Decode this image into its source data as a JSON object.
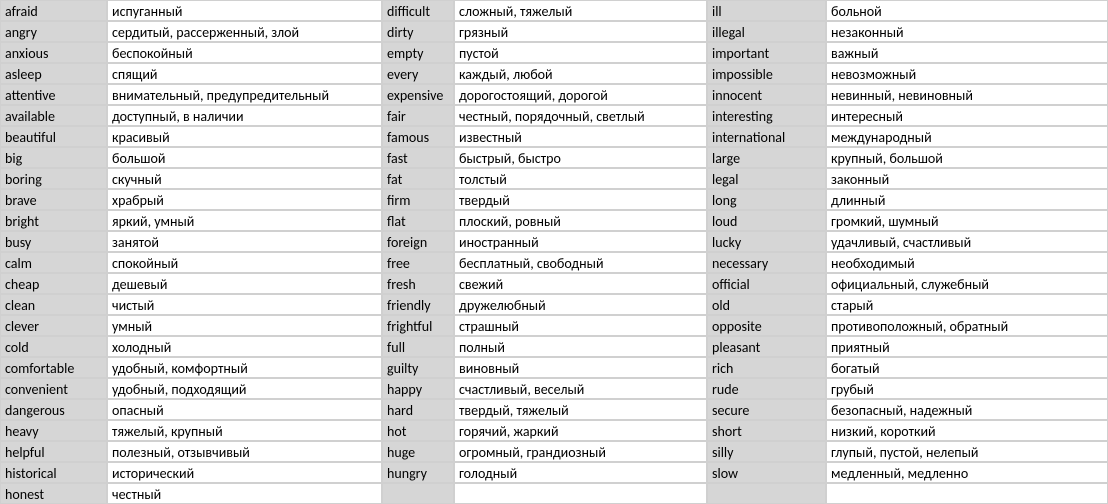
{
  "columns": [
    [
      {
        "en": "afraid",
        "ru": "испуганный"
      },
      {
        "en": "angry",
        "ru": "сердитый, рассерженный, злой"
      },
      {
        "en": "anxious",
        "ru": "беспокойный"
      },
      {
        "en": "asleep",
        "ru": "спящий"
      },
      {
        "en": "attentive",
        "ru": "внимательный, предупредительный"
      },
      {
        "en": "available",
        "ru": "доступный, в наличии"
      },
      {
        "en": "beautiful",
        "ru": "красивый"
      },
      {
        "en": "big",
        "ru": "большой"
      },
      {
        "en": "boring",
        "ru": "скучный"
      },
      {
        "en": "brave",
        "ru": "храбрый"
      },
      {
        "en": "bright",
        "ru": "яркий, умный"
      },
      {
        "en": "busy",
        "ru": "занятой"
      },
      {
        "en": "calm",
        "ru": "спокойный"
      },
      {
        "en": "cheap",
        "ru": "дешевый"
      },
      {
        "en": "clean",
        "ru": "чистый"
      },
      {
        "en": "clever",
        "ru": "умный"
      },
      {
        "en": "cold",
        "ru": "холодный"
      },
      {
        "en": "comfortable",
        "ru": "удобный, комфортный"
      },
      {
        "en": "convenient",
        "ru": "удобный, подходящий"
      },
      {
        "en": "dangerous",
        "ru": "опасный"
      },
      {
        "en": "heavy",
        "ru": "тяжелый, крупный"
      },
      {
        "en": "helpful",
        "ru": "полезный, отзывчивый"
      },
      {
        "en": "historical",
        "ru": "исторический"
      },
      {
        "en": "honest",
        "ru": "честный"
      }
    ],
    [
      {
        "en": "difficult",
        "ru": "сложный, тяжелый"
      },
      {
        "en": "dirty",
        "ru": "грязный"
      },
      {
        "en": "empty",
        "ru": "пустой"
      },
      {
        "en": "every",
        "ru": "каждый, любой"
      },
      {
        "en": "expensive",
        "ru": "дорогостоящий, дорогой"
      },
      {
        "en": "fair",
        "ru": "честный, порядочный, светлый"
      },
      {
        "en": "famous",
        "ru": "известный"
      },
      {
        "en": "fast",
        "ru": "быстрый, быстро"
      },
      {
        "en": "fat",
        "ru": "толстый"
      },
      {
        "en": "firm",
        "ru": "твердый"
      },
      {
        "en": "flat",
        "ru": "плоский, ровный"
      },
      {
        "en": "foreign",
        "ru": "иностранный"
      },
      {
        "en": "free",
        "ru": "бесплатный, свободный"
      },
      {
        "en": "fresh",
        "ru": "свежий"
      },
      {
        "en": "friendly",
        "ru": "дружелюбный"
      },
      {
        "en": "frightful",
        "ru": "страшный"
      },
      {
        "en": "full",
        "ru": "полный"
      },
      {
        "en": "guilty",
        "ru": "виновный"
      },
      {
        "en": "happy",
        "ru": "счастливый, веселый"
      },
      {
        "en": "hard",
        "ru": "твердый, тяжелый"
      },
      {
        "en": "hot",
        "ru": "горячий, жаркий"
      },
      {
        "en": "huge",
        "ru": "огромный, грандиозный"
      },
      {
        "en": "hungry",
        "ru": "голодный"
      },
      {
        "en": "",
        "ru": ""
      }
    ],
    [
      {
        "en": "ill",
        "ru": "больной"
      },
      {
        "en": "illegal",
        "ru": "незаконный"
      },
      {
        "en": "important",
        "ru": "важный"
      },
      {
        "en": "impossible",
        "ru": "невозможный"
      },
      {
        "en": "innocent",
        "ru": "невинный, невиновный"
      },
      {
        "en": "interesting",
        "ru": "интересный"
      },
      {
        "en": "international",
        "ru": "международный"
      },
      {
        "en": "large",
        "ru": "крупный, большой"
      },
      {
        "en": "legal",
        "ru": "законный"
      },
      {
        "en": "long",
        "ru": "длинный"
      },
      {
        "en": "loud",
        "ru": "громкий, шумный"
      },
      {
        "en": "lucky",
        "ru": "удачливый, счастливый"
      },
      {
        "en": "necessary",
        "ru": "необходимый"
      },
      {
        "en": "official",
        "ru": "официальный, служебный"
      },
      {
        "en": "old",
        "ru": "старый"
      },
      {
        "en": "opposite",
        "ru": "противоположный, обратный"
      },
      {
        "en": "pleasant",
        "ru": "приятный"
      },
      {
        "en": "rich",
        "ru": "богатый"
      },
      {
        "en": "rude",
        "ru": "грубый"
      },
      {
        "en": "secure",
        "ru": "безопасный, надежный"
      },
      {
        "en": "short",
        "ru": "низкий, короткий"
      },
      {
        "en": "silly",
        "ru": "глупый, пустой, нелепый"
      },
      {
        "en": "slow",
        "ru": "медленный, медленно"
      },
      {
        "en": "",
        "ru": ""
      }
    ]
  ]
}
